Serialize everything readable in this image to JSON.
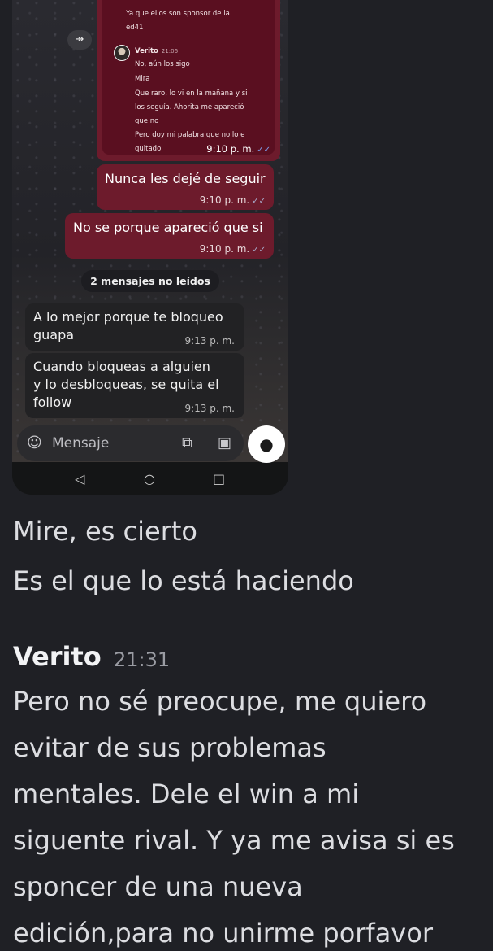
{
  "phone": {
    "quoted": {
      "lines_top": [
        "Ya que ellos son sponsor de la",
        "ed41"
      ],
      "author": "Verito",
      "author_time": "21:06",
      "lines": [
        "No, aún los sigo",
        "Mira",
        "Que raro, lo vi en la mañana y si",
        "los seguía. Ahorita me apareció",
        "que no",
        "Pero doy mi palabra que no lo e",
        "quitado"
      ],
      "time": "9:10 p. m."
    },
    "outgoing": [
      {
        "text": "Nunca les dejé de seguir",
        "time": "9:10 p. m."
      },
      {
        "text": "No se porque apareció que si",
        "time": "9:10 p. m."
      }
    ],
    "unread_label": "2 mensajes no leídos",
    "incoming": [
      {
        "lines": [
          "A lo mejor porque te bloqueo",
          "guapa"
        ],
        "time": "9:13 p. m."
      },
      {
        "lines": [
          "Cuando bloqueas a alguien",
          "y lo desbloqueas, se quita el",
          "follow"
        ],
        "time": "9:13 p. m."
      }
    ],
    "input_placeholder": "Mensaje",
    "icons": {
      "forward": "forward-icon",
      "sticker": "sticker-icon",
      "attach": "paperclip-icon",
      "camera": "camera-icon",
      "mic": "mic-icon",
      "back": "nav-back-icon",
      "home": "nav-home-icon",
      "recents": "nav-recents-icon",
      "read": "double-check-icon"
    }
  },
  "discord": {
    "lines_before": [
      "Mire, es cierto",
      "Es el que lo está haciendo"
    ],
    "author": "Verito",
    "timestamp": "21:31",
    "message_lines": [
      "Pero no sé preocupe, me quiero",
      "evitar de sus problemas",
      "mentales. Dele el win a mi",
      "siguente rival. Y ya me avisa si es",
      "sponcer de una nueva",
      "edición,para no unirme porfavor"
    ]
  },
  "colors": {
    "background": "#1f2025",
    "outgoing_bubble": "#6d1b2c",
    "incoming_bubble": "#222224",
    "read_tick": "#7f9be8"
  }
}
